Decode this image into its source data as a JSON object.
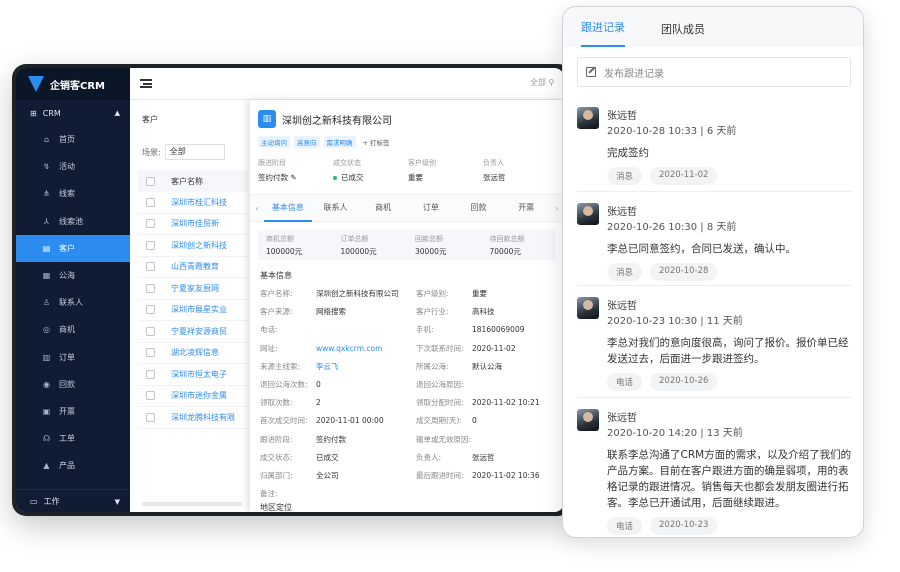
{
  "app": {
    "name": "企销客CRM"
  },
  "sidebar": {
    "group": "CRM",
    "items": [
      {
        "label": "首页",
        "icon": "home-icon",
        "glyph": "⌂"
      },
      {
        "label": "活动",
        "icon": "activity-icon",
        "glyph": "↯"
      },
      {
        "label": "线索",
        "icon": "lead-icon",
        "glyph": "⋔"
      },
      {
        "label": "线索池",
        "icon": "lead-pool-icon",
        "glyph": "⅄"
      },
      {
        "label": "客户",
        "icon": "customer-icon",
        "glyph": "▤",
        "active": true
      },
      {
        "label": "公海",
        "icon": "public-sea-icon",
        "glyph": "▦"
      },
      {
        "label": "联系人",
        "icon": "contact-icon",
        "glyph": "♙"
      },
      {
        "label": "商机",
        "icon": "opportunity-icon",
        "glyph": "◎"
      },
      {
        "label": "订单",
        "icon": "order-icon",
        "glyph": "▥"
      },
      {
        "label": "回款",
        "icon": "payment-icon",
        "glyph": "◉"
      },
      {
        "label": "开票",
        "icon": "invoice-icon",
        "glyph": "▣"
      },
      {
        "label": "工单",
        "icon": "ticket-icon",
        "glyph": "☊"
      },
      {
        "label": "产品",
        "icon": "product-icon",
        "glyph": "▲"
      }
    ],
    "work": "工作"
  },
  "topbar": {
    "search": "全部"
  },
  "list": {
    "breadcrumb": "客户",
    "scene_label": "场景:",
    "scene_value": "全部",
    "header": "客户名称",
    "rows": [
      "深圳市桂汇科技",
      "深圳市佳贸新",
      "深圳创之新科技",
      "山西青霞教育",
      "宁夏家友厨网",
      "深圳市展星实业",
      "宁夏祥安源商贸",
      "湖北凌辉信息",
      "深圳市恒太电子",
      "深圳市迷你金属",
      "深圳龙腾科技有限"
    ]
  },
  "detail": {
    "company": "深圳创之新科技有限公司",
    "tags": [
      "主动询问",
      "高意向",
      "需求明确"
    ],
    "add_tag": "+ 打标签",
    "summary": [
      {
        "k": "跟进阶段",
        "v": "签约付款 ✎"
      },
      {
        "k": "成交状态",
        "v": "已成交",
        "dot": true
      },
      {
        "k": "客户级别",
        "v": "重要"
      },
      {
        "k": "负责人",
        "v": "张远哲"
      }
    ],
    "tabs": [
      "基本信息",
      "联系人",
      "商机",
      "订单",
      "回款",
      "开票"
    ],
    "amounts": [
      {
        "k": "商机总额",
        "v": "100000元"
      },
      {
        "k": "订单总额",
        "v": "100000元"
      },
      {
        "k": "回款总额",
        "v": "30000元"
      },
      {
        "k": "待回款总额",
        "v": "70000元"
      }
    ],
    "section": "基本信息",
    "left_fields": [
      {
        "k": "客户名称:",
        "v": "深圳创之新科技有限公司"
      },
      {
        "k": "客户来源:",
        "v": "网络搜索"
      },
      {
        "k": "电话:",
        "v": ""
      },
      {
        "k": "网址:",
        "v": "www.qxkcrm.com",
        "link": true
      },
      {
        "k": "来源主线索:",
        "v": "李云飞",
        "link": true
      },
      {
        "k": "退回公海次数:",
        "v": "0"
      },
      {
        "k": "领取次数:",
        "v": "2"
      },
      {
        "k": "首次成交时间:",
        "v": "2020-11-01 00:00"
      },
      {
        "k": "跟进阶段:",
        "v": "签约付款"
      },
      {
        "k": "成交状态:",
        "v": "已成交"
      },
      {
        "k": "归属部门:",
        "v": "全公司"
      },
      {
        "k": "备注:",
        "v": ""
      }
    ],
    "right_fields": [
      {
        "k": "客户级别:",
        "v": "重要"
      },
      {
        "k": "客户行业:",
        "v": "高科技"
      },
      {
        "k": "手机:",
        "v": "18160069009"
      },
      {
        "k": "下次联系时间:",
        "v": "2020-11-02"
      },
      {
        "k": "所属公海:",
        "v": "默认公海"
      },
      {
        "k": "退回公海原因:",
        "v": ""
      },
      {
        "k": "领取分配时间:",
        "v": "2020-11-02 10:21"
      },
      {
        "k": "成交周期(天):",
        "v": "0"
      },
      {
        "k": "输单或无效原因:",
        "v": ""
      },
      {
        "k": "负责人:",
        "v": "张远哲"
      },
      {
        "k": "最后跟进时间:",
        "v": "2020-11-02 10:36"
      }
    ],
    "section2": "地区定位"
  },
  "follow": {
    "tabs": [
      "跟进记录",
      "团队成员"
    ],
    "placeholder": "发布跟进记录",
    "records": [
      {
        "name": "张远哲",
        "time": "2020-10-28 10:33 | 6 天前",
        "text": "完成签约",
        "chips": [
          "消息",
          "2020-11-02"
        ]
      },
      {
        "name": "张远哲",
        "time": "2020-10-26 10:30 | 8 天前",
        "text": "李总已同意签约，合同已发送，确认中。",
        "chips": [
          "消息",
          "2020-10-28"
        ]
      },
      {
        "name": "张远哲",
        "time": "2020-10-23 10:30 | 11 天前",
        "text": "李总对我们的意向度很高，询问了报价。报价单已经发送过去，后面进一步跟进签约。",
        "chips": [
          "电话",
          "2020-10-26"
        ]
      },
      {
        "name": "张远哲",
        "time": "2020-10-20 14:20 | 13 天前",
        "text": "联系李总沟通了CRM方面的需求，以及介绍了我们的产品方案。目前在客户跟进方面的确是弱项，用的表格记录的跟进情况。销售每天也都会发朋友圈进行拓客。李总已开通试用，后面继续跟进。",
        "chips": [
          "电话",
          "2020-10-23"
        ]
      }
    ]
  }
}
